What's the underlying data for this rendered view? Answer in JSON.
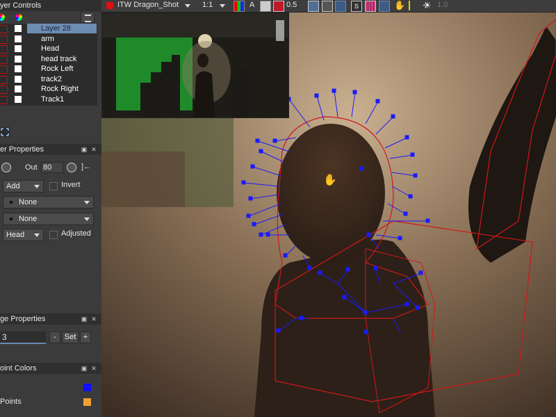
{
  "left_panel": {
    "layer_controls_title": "yer Controls",
    "layers": [
      {
        "name": "Layer 28",
        "selected": true
      },
      {
        "name": "arm",
        "selected": false
      },
      {
        "name": "Head",
        "selected": false
      },
      {
        "name": "head track",
        "selected": false
      },
      {
        "name": "Rock Left",
        "selected": false
      },
      {
        "name": "track2",
        "selected": false
      },
      {
        "name": "Rock Right",
        "selected": false
      },
      {
        "name": "Track1",
        "selected": false
      }
    ],
    "layer_properties_title": "er Properties",
    "out_label": "Out",
    "out_value": "80",
    "blend_mode": "Add",
    "invert_label": "Invert",
    "matte_1": "None",
    "matte_2": "None",
    "track_layer": "Head",
    "adjusted_label": "Adjusted",
    "edge_properties_title": "ge Properties",
    "edge_value": "3",
    "minus_label": "-",
    "set_label": "Set",
    "plus_label": "+",
    "point_colors_title": "oint Colors",
    "points_label": "Points",
    "point_color_1": "#1010ff",
    "point_color_2": "#f0a030"
  },
  "toolbar": {
    "shot_name": "ITW Dragon_Shot",
    "zoom": "1:1",
    "a_label": "A",
    "opacity": "0.5",
    "s_label": "S",
    "right_value": "1.0"
  }
}
